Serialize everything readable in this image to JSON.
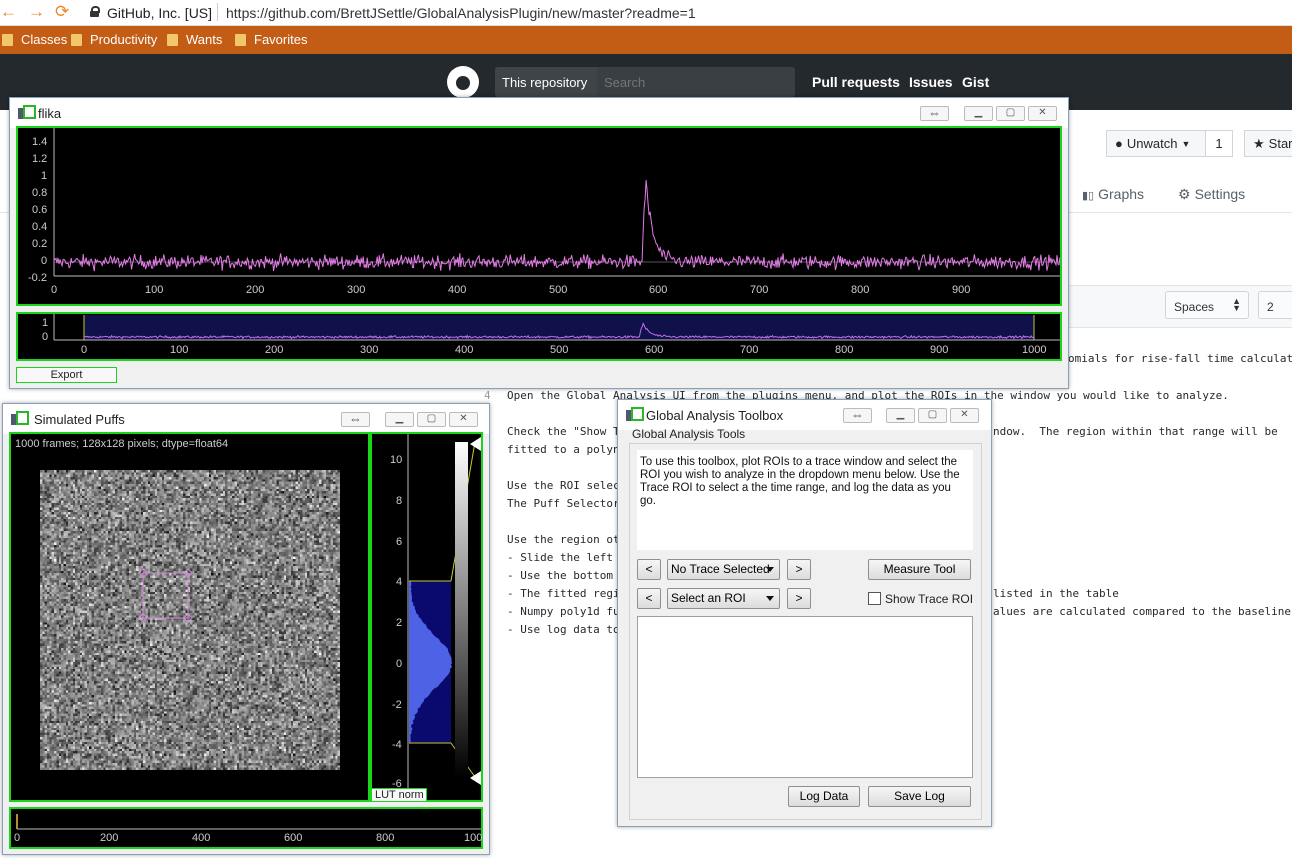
{
  "browser": {
    "back": "←",
    "forward": "→",
    "reload": "⟳",
    "site_identity": "GitHub, Inc. [US]",
    "url": "https://github.com/BrettJSettle/GlobalAnalysisPlugin/new/master?readme=1",
    "bookmarks": [
      "Classes",
      "Productivity",
      "Wants",
      "Favorites"
    ]
  },
  "github": {
    "scope": "This repository",
    "search_placeholder": "Search",
    "nav": [
      "Pull requests",
      "Issues",
      "Gist"
    ],
    "unwatch_label": "Unwatch",
    "watch_count": "1",
    "star_label": "Star",
    "tabs": [
      "Graphs",
      "Settings"
    ],
    "indent_mode": "Spaces",
    "indent_size": "2",
    "line_number": "4",
    "code_lines": [
      "omials for rise-fall time calculat",
      "Open the Global Analysis UI from the plugins menu, and plot the ROIs in the window you would like to analyze.",
      "Check the \"Show T",
      "ndow.  The region within that range will be",
      "fitted to a polyn",
      "Use the ROI selec",
      "The Puff Selector",
      "Use the region ot",
      "- Slide the left",
      "- Use the bottom",
      "- The fitted regi",
      "listed in the table",
      "- Numpy poly1d fu",
      "alues are calculated compared to the baseline",
      "- Use log data to"
    ]
  },
  "flika": {
    "title": "flika",
    "restore_icon": "⇔",
    "export_label": "Export",
    "main_plot": {
      "y_ticks": [
        "1.4",
        "1.2",
        "1",
        "0.8",
        "0.6",
        "0.4",
        "0.2",
        "0",
        "-0.2"
      ],
      "x_ticks": [
        "0",
        "100",
        "200",
        "300",
        "400",
        "500",
        "600",
        "700",
        "800",
        "900"
      ]
    },
    "overview_plot": {
      "y_ticks": [
        "1",
        "0"
      ],
      "x_ticks": [
        "0",
        "100",
        "200",
        "300",
        "400",
        "500",
        "600",
        "700",
        "800",
        "900",
        "1000"
      ]
    }
  },
  "puffs": {
    "title": "Simulated Puffs",
    "restore_icon": "⇔",
    "info": "1000 frames; 128x128 pixels; dtype=float64",
    "hist_ticks": [
      "10",
      "8",
      "6",
      "4",
      "2",
      "0",
      "-2",
      "-4",
      "-6"
    ],
    "lut_label": "LUT norm",
    "timeline_ticks": [
      "0",
      "200",
      "400",
      "600",
      "800",
      "100"
    ]
  },
  "toolbox": {
    "title": "Global Analysis Toolbox",
    "restore_icon": "⇔",
    "group_title": "Global Analysis Tools",
    "description": "To use this toolbox, plot ROIs to a trace window and select the ROI you wish to analyze in the dropdown menu below. Use the Trace ROI to select a the time range, and log the data as you go.",
    "prev": "<",
    "next": ">",
    "trace_combo": "No Trace Selected",
    "roi_combo": "Select an ROI",
    "measure_tool": "Measure Tool",
    "show_trace_roi": "Show Trace ROI",
    "log_data": "Log Data",
    "save_log": "Save Log"
  },
  "colors": {
    "trace": "#e27be6",
    "plot_border": "#1ad51a",
    "bookmark_bar": "#c35c14",
    "github_header": "#24292e"
  }
}
